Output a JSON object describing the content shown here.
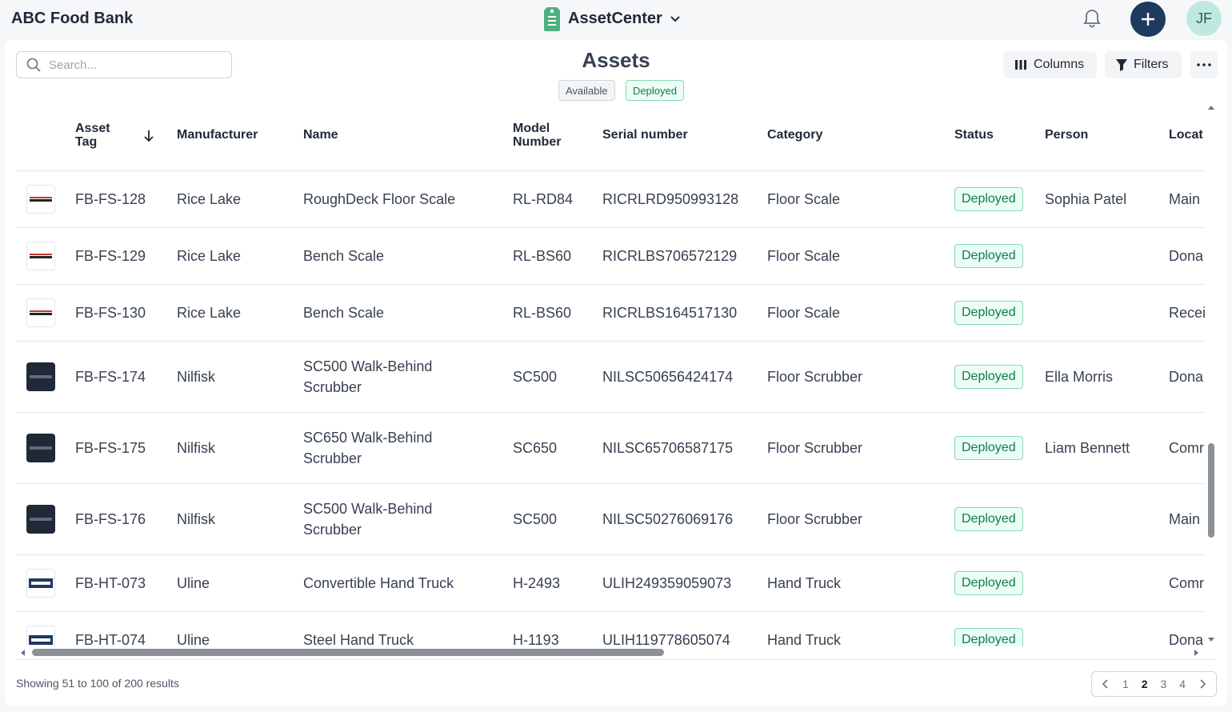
{
  "header": {
    "org_name": "ABC Food Bank",
    "app_name": "AssetCenter",
    "user_initials": "JF",
    "accent_color": "#1e3a5f"
  },
  "toolbar": {
    "search_placeholder": "Search...",
    "page_title": "Assets",
    "chips": [
      "Available",
      "Deployed"
    ],
    "columns_label": "Columns",
    "filters_label": "Filters"
  },
  "table": {
    "headers": {
      "asset_tag": "Asset Tag",
      "manufacturer": "Manufacturer",
      "name": "Name",
      "model_number": "Model Number",
      "serial_number": "Serial number",
      "category": "Category",
      "status": "Status",
      "person": "Person",
      "location": "Locat"
    },
    "sorted_column": "asset_tag",
    "sort_direction": "descending",
    "rows": [
      {
        "logo": "RICE LAKE",
        "tag": "FB-FS-128",
        "manufacturer": "Rice Lake",
        "name1": "RoughDeck Floor Scale",
        "name2": "",
        "model": "RL-RD84",
        "serial": "RICRLRD950993128",
        "category": "Floor Scale",
        "status": "Deployed",
        "person": "Sophia Patel",
        "location": "Main"
      },
      {
        "logo": "RICE LAKE",
        "tag": "FB-FS-129",
        "manufacturer": "Rice Lake",
        "name1": "Bench Scale",
        "name2": "",
        "model": "RL-BS60",
        "serial": "RICRLBS706572129",
        "category": "Floor Scale",
        "status": "Deployed",
        "person": "",
        "location": "Dona"
      },
      {
        "logo": "RICE LAKE",
        "tag": "FB-FS-130",
        "manufacturer": "Rice Lake",
        "name1": "Bench Scale",
        "name2": "",
        "model": "RL-BS60",
        "serial": "RICRLBS164517130",
        "category": "Floor Scale",
        "status": "Deployed",
        "person": "",
        "location": "Recei"
      },
      {
        "logo": "NILFISK",
        "tag": "FB-FS-174",
        "manufacturer": "Nilfisk",
        "name1": "SC500 Walk-Behind",
        "name2": "Scrubber",
        "model": "SC500",
        "serial": "NILSC50656424174",
        "category": "Floor Scrubber",
        "status": "Deployed",
        "person": "Ella Morris",
        "location": "Dona"
      },
      {
        "logo": "NILFISK",
        "tag": "FB-FS-175",
        "manufacturer": "Nilfisk",
        "name1": "SC650 Walk-Behind",
        "name2": "Scrubber",
        "model": "SC650",
        "serial": "NILSC65706587175",
        "category": "Floor Scrubber",
        "status": "Deployed",
        "person": "Liam Bennett",
        "location": "Comr"
      },
      {
        "logo": "NILFISK",
        "tag": "FB-FS-176",
        "manufacturer": "Nilfisk",
        "name1": "SC500 Walk-Behind",
        "name2": "Scrubber",
        "model": "SC500",
        "serial": "NILSC50276069176",
        "category": "Floor Scrubber",
        "status": "Deployed",
        "person": "",
        "location": "Main"
      },
      {
        "logo": "ULINE",
        "tag": "FB-HT-073",
        "manufacturer": "Uline",
        "name1": "Convertible Hand Truck",
        "name2": "",
        "model": "H-2493",
        "serial": "ULIH249359059073",
        "category": "Hand Truck",
        "status": "Deployed",
        "person": "",
        "location": "Comr"
      },
      {
        "logo": "ULINE",
        "tag": "FB-HT-074",
        "manufacturer": "Uline",
        "name1": "Steel Hand Truck",
        "name2": "",
        "model": "H-1193",
        "serial": "ULIH119778605074",
        "category": "Hand Truck",
        "status": "Deployed",
        "person": "",
        "location": "Dona"
      }
    ]
  },
  "footer": {
    "results_text": "Showing 51 to 100 of 200 results",
    "pages": [
      "1",
      "2",
      "3",
      "4"
    ],
    "current_page": "2"
  }
}
